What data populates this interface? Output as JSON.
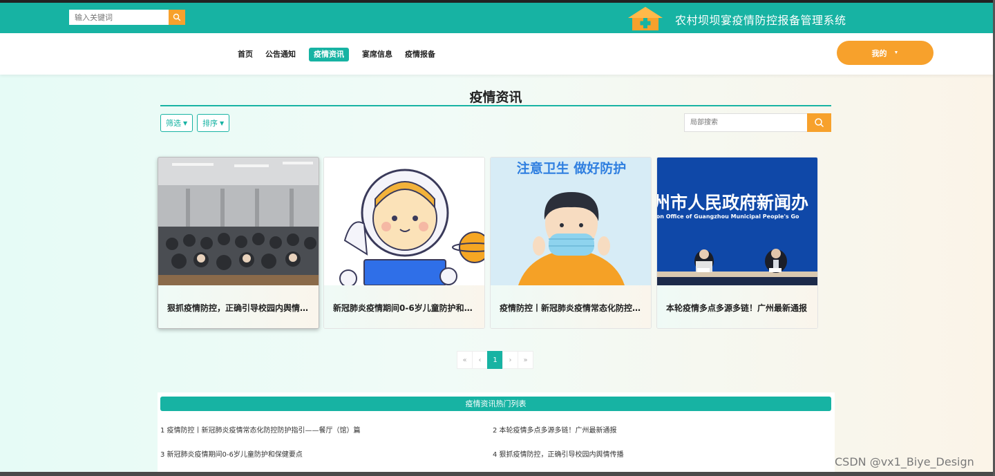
{
  "header": {
    "search_placeholder": "输入关键词",
    "site_title": "农村坝坝宴疫情防控报备管理系统"
  },
  "nav": {
    "items": [
      "首页",
      "公告通知",
      "疫情资讯",
      "宴席信息",
      "疫情报备"
    ],
    "active_index": 2,
    "mine_label": "我的"
  },
  "page": {
    "heading": "疫情资讯",
    "filter_label": "筛选",
    "sort_label": "排序",
    "search_placeholder": "局部搜索"
  },
  "cards": [
    {
      "title": "狠抓疫情防控，正确引导校园内舆情传播"
    },
    {
      "title": "新冠肺炎疫情期间0-6岁儿童防护和保健要点"
    },
    {
      "title": "疫情防控丨新冠肺炎疫情常态化防控防护指引——餐厅（馆）篇"
    },
    {
      "title": "本轮疫情多点多源多链！广州最新通报"
    }
  ],
  "card_images": {
    "card3_banner": "注意卫生 做好防护",
    "card4_banner": "州市人民政府新闻办",
    "card4_subtitle": "ion Office of Guangzhou Municipal People's Go"
  },
  "pagination": {
    "first": "«",
    "prev": "‹",
    "current": "1",
    "next": "›",
    "last": "»"
  },
  "hot_list": {
    "title": "疫情资讯热门列表",
    "items": [
      "1  疫情防控丨新冠肺炎疫情常态化防控防护指引——餐厅（馆）篇",
      "2  本轮疫情多点多源多链！广州最新通报",
      "3  新冠肺炎疫情期间0-6岁儿童防护和保健要点",
      "4  狠抓疫情防控，正确引导校园内舆情传播"
    ]
  },
  "watermark": "CSDN @vx1_Biye_Design",
  "colors": {
    "primary": "#17b3a3",
    "accent": "#f7a12c"
  }
}
